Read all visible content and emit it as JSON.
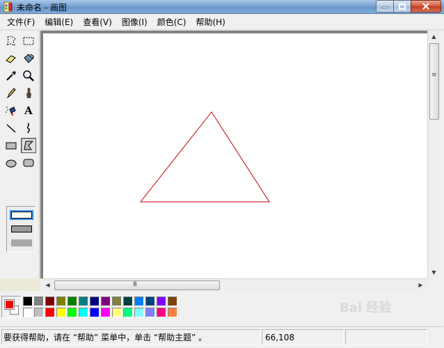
{
  "window": {
    "title": "未命名 - 画图",
    "app_icon": "paint-icon"
  },
  "menu": [
    {
      "label": "文件(F)"
    },
    {
      "label": "编辑(E)"
    },
    {
      "label": "查看(V)"
    },
    {
      "label": "图像(I)"
    },
    {
      "label": "颜色(C)"
    },
    {
      "label": "帮助(H)"
    }
  ],
  "tools": [
    {
      "name": "free-select-icon"
    },
    {
      "name": "rect-select-icon"
    },
    {
      "name": "eraser-icon"
    },
    {
      "name": "fill-icon"
    },
    {
      "name": "color-picker-icon"
    },
    {
      "name": "magnifier-icon"
    },
    {
      "name": "pencil-icon"
    },
    {
      "name": "brush-icon"
    },
    {
      "name": "airbrush-icon"
    },
    {
      "name": "text-icon",
      "glyph": "A"
    },
    {
      "name": "line-icon"
    },
    {
      "name": "curve-icon"
    },
    {
      "name": "rectangle-icon"
    },
    {
      "name": "polygon-icon",
      "selected": true
    },
    {
      "name": "ellipse-icon"
    },
    {
      "name": "rounded-rect-icon"
    }
  ],
  "canvas": {
    "shape": "triangle",
    "stroke_color": "#c00000"
  },
  "colors": {
    "foreground": "#ff0000",
    "background": "#ffffff",
    "palette_top": [
      "#000000",
      "#808080",
      "#800000",
      "#808000",
      "#008000",
      "#008080",
      "#000080",
      "#800080",
      "#808040",
      "#004040",
      "#0080ff",
      "#004080",
      "#8000ff",
      "#804000"
    ],
    "palette_bottom": [
      "#ffffff",
      "#c0c0c0",
      "#ff0000",
      "#ffff00",
      "#00ff00",
      "#00ffff",
      "#0000ff",
      "#ff00ff",
      "#ffff80",
      "#00ff80",
      "#80ffff",
      "#8080ff",
      "#ff0080",
      "#ff8040"
    ]
  },
  "status": {
    "help_text": "要获得帮助，请在 “帮助” 菜单中，单击 “帮助主题” 。",
    "coords": "66,108"
  },
  "watermark": {
    "text": "Bai 经验"
  }
}
